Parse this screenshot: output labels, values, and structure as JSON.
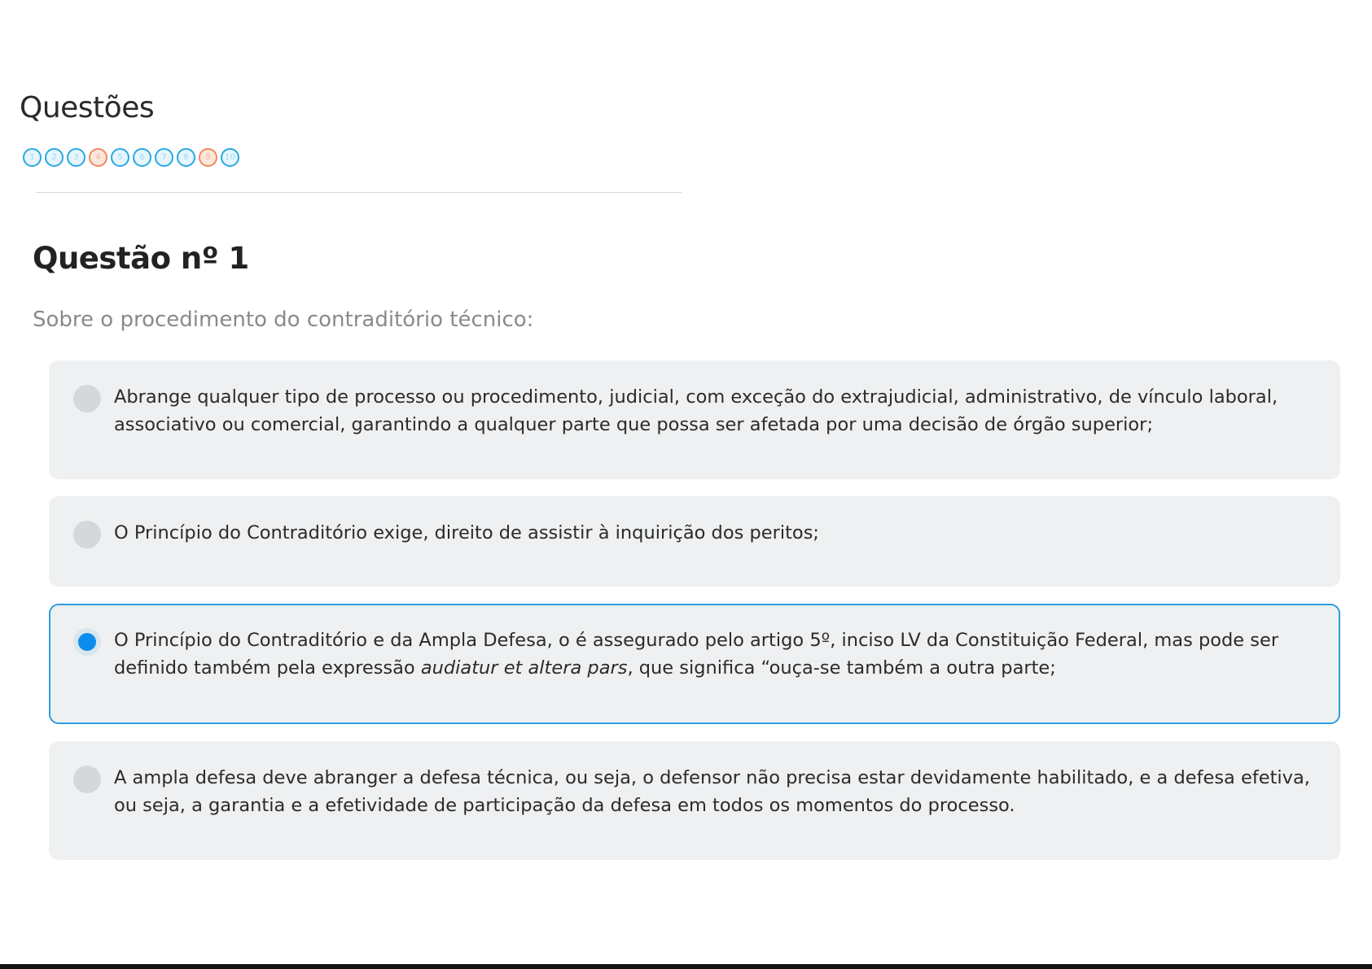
{
  "section": {
    "title": "Questões"
  },
  "navigation": {
    "items": [
      {
        "label": "1",
        "state": "pending"
      },
      {
        "label": "2",
        "state": "pending"
      },
      {
        "label": "3",
        "state": "pending"
      },
      {
        "label": "4",
        "state": "answered"
      },
      {
        "label": "5",
        "state": "pending"
      },
      {
        "label": "6",
        "state": "pending"
      },
      {
        "label": "7",
        "state": "pending"
      },
      {
        "label": "8",
        "state": "pending"
      },
      {
        "label": "9",
        "state": "answered"
      },
      {
        "label": "10",
        "state": "pending"
      }
    ]
  },
  "question": {
    "title": "Questão nº 1",
    "text": "Sobre o procedimento do contraditório técnico:",
    "options": [
      {
        "text": "Abrange qualquer tipo de processo ou procedimento, judicial, com exceção do extrajudicial, administrativo, de vínculo laboral, associativo ou comercial, garantindo a qualquer parte que possa ser afetada por uma decisão de órgão superior;"
      },
      {
        "text": "O Princípio do Contraditório exige, direito de assistir à inquirição dos peritos;"
      },
      {
        "text_before": "O Princípio do Contraditório e da Ampla Defesa, o é assegurado pelo artigo 5º, inciso LV da Constituição Federal, mas pode ser definido também pela expressão ",
        "text_italic": "audiatur et altera pars",
        "text_after": ", que significa “ouça-se também a outra parte;"
      },
      {
        "text": "A ampla defesa deve abranger a defesa técnica, ou seja, o defensor  não precisa estar devidamente habilitado, e a defesa efetiva, ou seja, a garantia e a efetividade de participação da defesa em todos os momentos do processo."
      }
    ],
    "selected_option": 3
  },
  "colors": {
    "accent": "#0d8cf0",
    "nav_pending": "#29a8e0",
    "nav_answered": "#f08a5d",
    "option_bg": "#eef0f1"
  }
}
